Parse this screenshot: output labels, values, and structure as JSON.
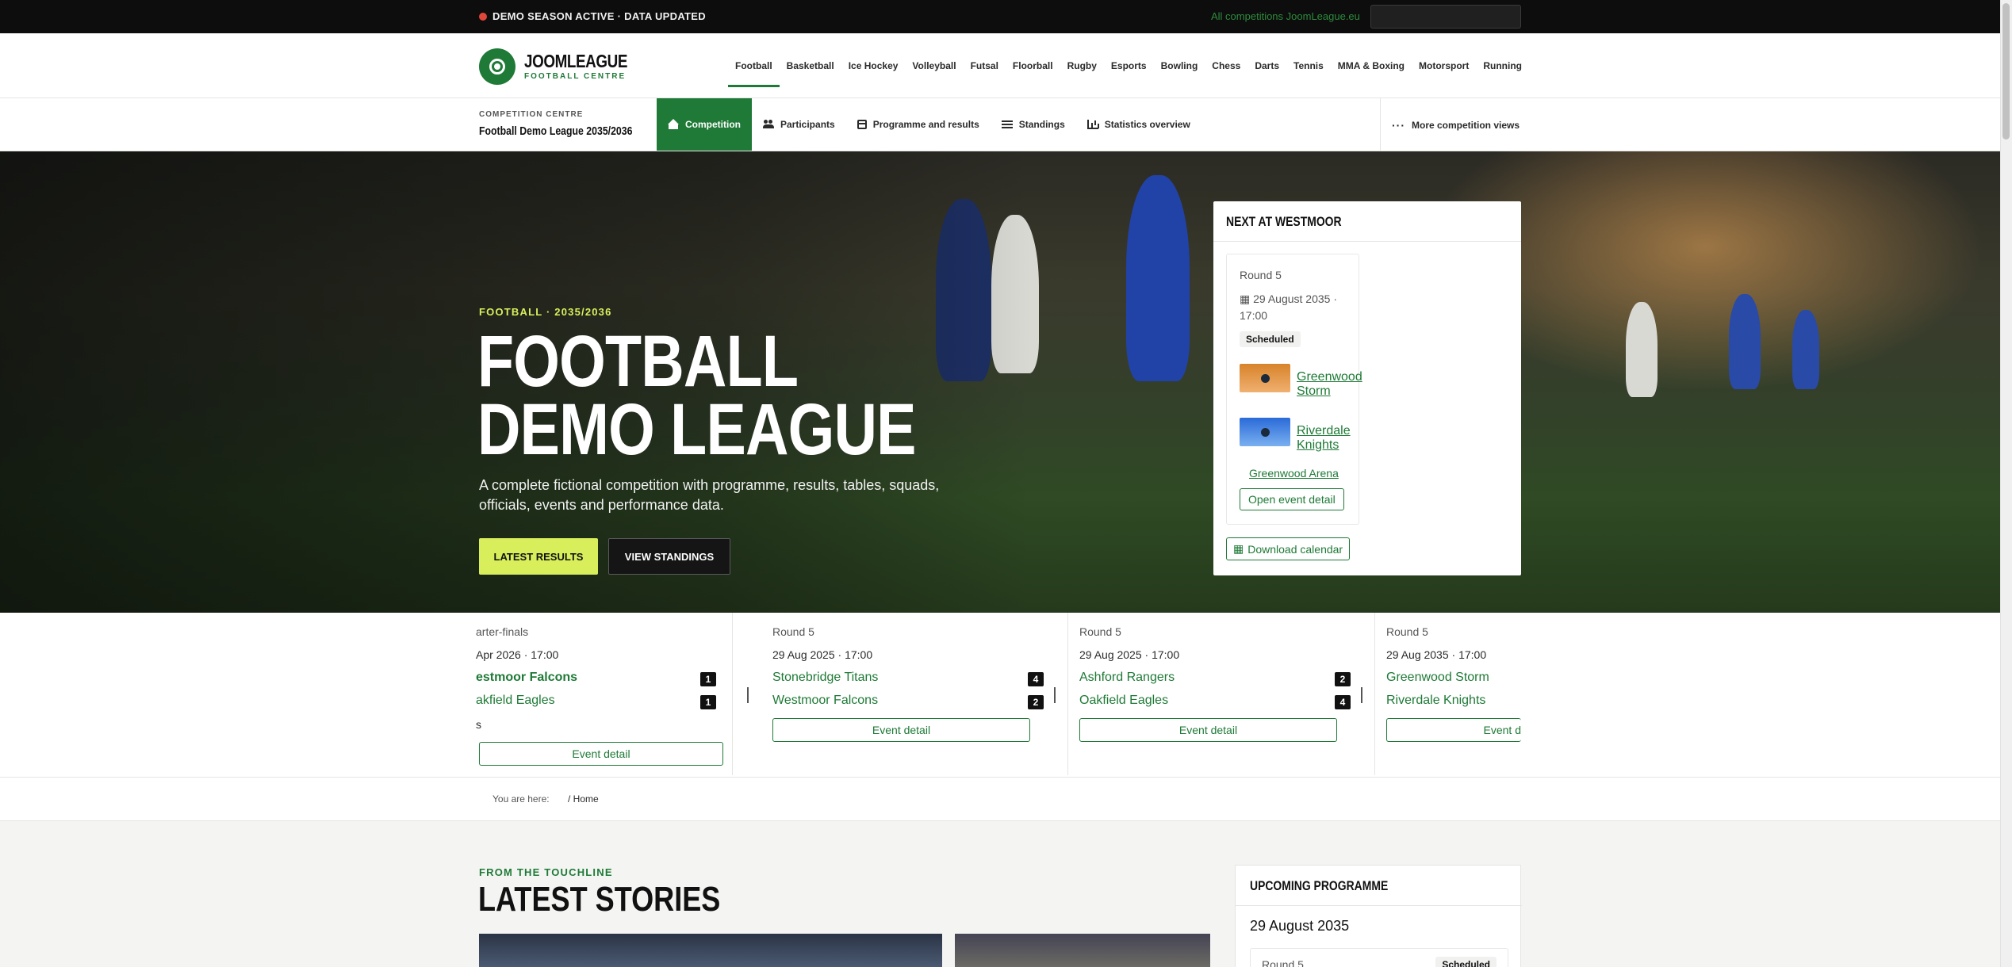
{
  "topbar": {
    "notice": "DEMO SEASON ACTIVE · DATA UPDATED",
    "all_competitions": "All competitions JoomLeague.eu",
    "search_placeholder": ""
  },
  "brand": {
    "name": "JOOMLEAGUE",
    "subtitle": "FOOTBALL CENTRE"
  },
  "sports_nav": [
    {
      "label": "Football",
      "active": true
    },
    {
      "label": "Basketball"
    },
    {
      "label": "Ice Hockey"
    },
    {
      "label": "Volleyball"
    },
    {
      "label": "Futsal"
    },
    {
      "label": "Floorball"
    },
    {
      "label": "Rugby"
    },
    {
      "label": "Esports"
    },
    {
      "label": "Bowling"
    },
    {
      "label": "Chess"
    },
    {
      "label": "Darts"
    },
    {
      "label": "Tennis"
    },
    {
      "label": "MMA & Boxing"
    },
    {
      "label": "Motorsport"
    },
    {
      "label": "Running"
    }
  ],
  "competition": {
    "label": "COMPETITION CENTRE",
    "title": "Football Demo League 2035/2036",
    "nav": [
      {
        "label": "Competition",
        "icon": "home-icon",
        "active": true
      },
      {
        "label": "Participants",
        "icon": "users-icon"
      },
      {
        "label": "Programme and results",
        "icon": "calendar-icon"
      },
      {
        "label": "Standings",
        "icon": "list-icon"
      },
      {
        "label": "Statistics overview",
        "icon": "chart-icon"
      }
    ],
    "more": "More competition views"
  },
  "hero": {
    "kicker": "FOOTBALL · 2035/2036",
    "title": "FOOTBALL DEMO LEAGUE",
    "description": "A complete fictional competition with programme, results, tables, squads, officials, events and performance data.",
    "primary_button": "LATEST RESULTS",
    "secondary_button": "VIEW STANDINGS"
  },
  "next_card": {
    "title": "NEXT AT WESTMOOR",
    "round": "Round 5",
    "date": "29 August 2035 · 17:00",
    "status": "Scheduled",
    "home_team": "Greenwood Storm",
    "away_team": "Riverdale Knights",
    "venue": "Greenwood Arena",
    "open_label": "Open event detail",
    "calendar_label": "Download calendar"
  },
  "results_strip": [
    {
      "round": "arter-finals",
      "date": "Apr 2026 · 17:00",
      "home": "estmoor Falcons",
      "home_score": "1",
      "away": "akfield Eagles",
      "away_score": "1",
      "extra": "s",
      "button": "Event detail"
    },
    {
      "round": "Round 5",
      "date": "29 Aug 2025 · 17:00",
      "home": "Stonebridge Titans",
      "home_score": "4",
      "away": "Westmoor Falcons",
      "away_score": "2",
      "button": "Event detail"
    },
    {
      "round": "Round 5",
      "date": "29 Aug 2025 · 17:00",
      "home": "Ashford Rangers",
      "home_score": "2",
      "away": "Oakfield Eagles",
      "away_score": "4",
      "button": "Event detail"
    },
    {
      "round": "Round 5",
      "date": "29 Aug 2035 · 17:00",
      "home": "Greenwood Storm",
      "home_score": "",
      "away": "Riverdale Knights",
      "away_score": "",
      "button": "Event d"
    }
  ],
  "breadcrumb": {
    "label": "You are here:",
    "home": "/  Home"
  },
  "stories": {
    "kicker": "FROM THE TOUCHLINE",
    "title": "LATEST STORIES"
  },
  "upcoming": {
    "title": "UPCOMING PROGRAMME",
    "date": "29 August 2035",
    "round": "Round 5",
    "status": "Scheduled"
  }
}
